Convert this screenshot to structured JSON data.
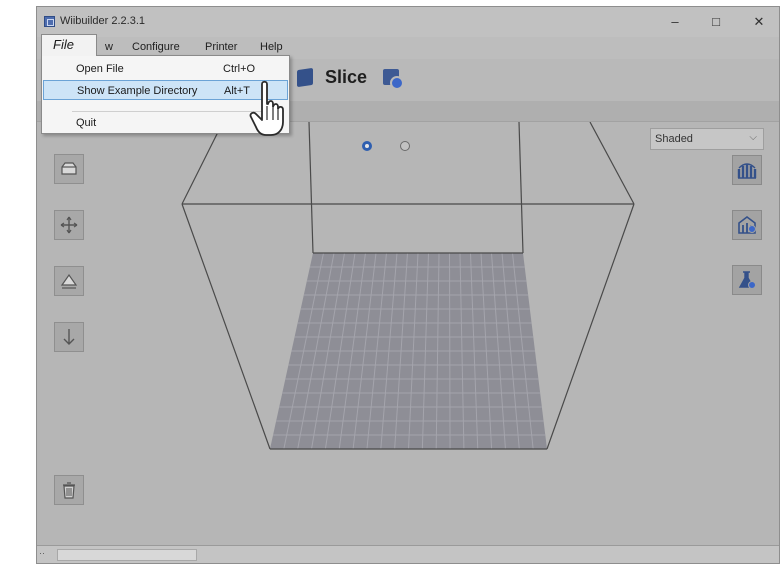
{
  "window": {
    "title": "Wiibuilder 2.2.3.1",
    "controls": {
      "minimize": "–",
      "maximize": "□",
      "close": "✕"
    }
  },
  "menubar": {
    "items": [
      "File",
      "w",
      "Configure",
      "Printer",
      "Help"
    ]
  },
  "file_menu": {
    "items": [
      {
        "label": "Open File",
        "shortcut": "Ctrl+O"
      },
      {
        "label": "Show Example Directory",
        "shortcut": "Alt+T"
      },
      {
        "label": "Quit",
        "shortcut": ""
      }
    ],
    "highlighted_index": 1
  },
  "toolbar": {
    "slice_label": "Slice"
  },
  "viewport": {
    "render_mode": "Shaded",
    "view_radio_selected": 0
  },
  "left_tools": [
    "open-model-icon",
    "move-icon",
    "rotate-icon",
    "drop-to-bed-icon",
    "trash-icon"
  ],
  "right_tools": [
    "layer-view-icon",
    "support-settings-icon",
    "flask-icon"
  ],
  "colors": {
    "background": "#b6b6b6",
    "bed": "#8e8e96",
    "accent": "#3c5b99",
    "menu_highlight": "#cde4f7"
  }
}
